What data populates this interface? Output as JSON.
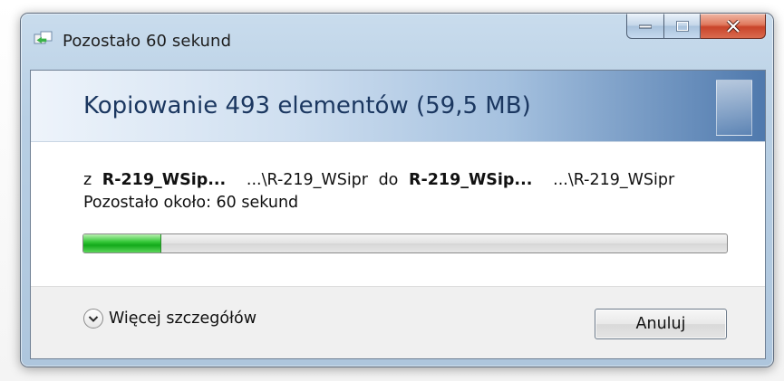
{
  "window": {
    "title": "Pozostało 60 sekund",
    "icon": "copy-files-icon",
    "controls": [
      "minimize-icon",
      "maximize-icon",
      "close-icon"
    ]
  },
  "banner": {
    "title": "Kopiowanie 493 elementów (59,5 MB)"
  },
  "transfer": {
    "from_prefix": "z",
    "source_name": "R-219_WSip...",
    "source_path": "...\\R-219_WSipr",
    "to_word": "do",
    "dest_name": "R-219_WSip...",
    "dest_path": "...\\R-219_WSipr",
    "remaining_text": "Pozostało około: 60 sekund",
    "progress_fraction": 0.12
  },
  "footer": {
    "details_label": "Więcej szczegółów",
    "cancel_label": "Anuluj"
  },
  "colors": {
    "progress_green": "#12a91a",
    "banner_title": "#1b3760",
    "close_red": "#c9442a"
  }
}
